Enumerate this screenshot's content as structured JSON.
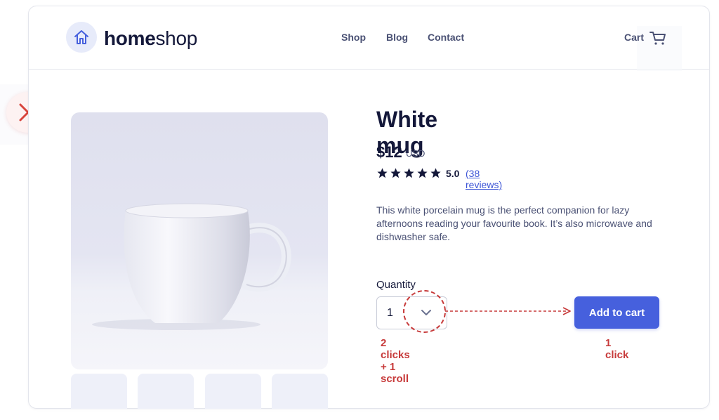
{
  "header": {
    "logo_bold": "home",
    "logo_regular": "shop",
    "nav": [
      "Shop",
      "Blog",
      "Contact"
    ],
    "cart_label": "Cart"
  },
  "product": {
    "title": "White mug",
    "price": "$12",
    "currency": "USD",
    "rating": "5.0",
    "stars": 5,
    "reviews": "(38 reviews)",
    "description": "This white porcelain mug is the perfect companion for lazy afternoons reading your favourite book. It’s also microwave and dishwasher safe."
  },
  "quantity": {
    "label": "Quantity",
    "value": "1"
  },
  "add_to_cart_label": "Add to cart",
  "annotations": {
    "dropdown": "2 clicks + 1 scroll",
    "button": "1 click"
  },
  "colors": {
    "accent": "#4660dd",
    "annotation": "#c73a3a",
    "text": "#14183a",
    "muted": "#4a5174"
  },
  "icons": {
    "logo": "house-icon",
    "cart": "cart-icon",
    "close": "close-icon",
    "dropdown": "chevron-down-icon",
    "star": "star-icon"
  }
}
